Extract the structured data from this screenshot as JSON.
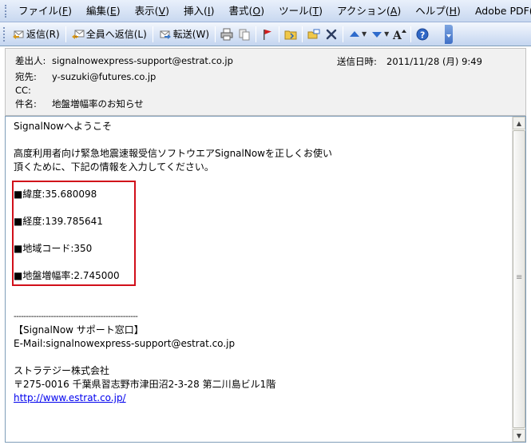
{
  "menu": [
    {
      "label": "ファイル(",
      "key": "F",
      "suffix": ")"
    },
    {
      "label": "編集(",
      "key": "E",
      "suffix": ")"
    },
    {
      "label": "表示(",
      "key": "V",
      "suffix": ")"
    },
    {
      "label": "挿入(",
      "key": "I",
      "suffix": ")"
    },
    {
      "label": "書式(",
      "key": "O",
      "suffix": ")"
    },
    {
      "label": "ツール(",
      "key": "T",
      "suffix": ")"
    },
    {
      "label": "アクション(",
      "key": "A",
      "suffix": ")"
    },
    {
      "label": "ヘルプ(",
      "key": "H",
      "suffix": ")"
    },
    {
      "label": "Adobe PDF(",
      "key": "P",
      "suffix": ")"
    }
  ],
  "toolbar": {
    "reply_label": "返信(R)",
    "reply_all_label": "全員へ返信(L)",
    "forward_label": "転送(W)"
  },
  "header": {
    "from_label": "差出人:",
    "from_value": "signalnowexpress-support@estrat.co.jp",
    "to_label": "宛先:",
    "to_value": "y-suzuki@futures.co.jp",
    "cc_label": "CC:",
    "cc_value": "",
    "subject_label": "件名:",
    "subject_value": "地盤増幅率のお知らせ",
    "sent_label": "送信日時:",
    "sent_value": "2011/11/28 (月) 9:49"
  },
  "body": {
    "greeting": "SignalNowへようこそ",
    "intro_1": "高度利用者向け緊急地震速報受信ソフトウエアSignalNowを正しくお使い",
    "intro_2": "頂くために、下記の情報を入力してください。",
    "latitude": "■緯度:35.680098",
    "longitude": "■経度:139.785641",
    "area_code": "■地域コード:350",
    "amplification": "■地盤増幅率:2.745000",
    "divider": "--------------------------------------------------",
    "support_title": "【SignalNow サポート窓口】",
    "support_email": "E-Mail:signalnowexpress-support@estrat.co.jp",
    "company": "ストラテジー株式会社",
    "address": "〒275-0016 千葉県習志野市津田沼2-3-28 第二川島ビル1階",
    "url": "http://www.estrat.co.jp/"
  },
  "colors": {
    "highlight": "#d10f1a",
    "link": "#0000ee"
  }
}
